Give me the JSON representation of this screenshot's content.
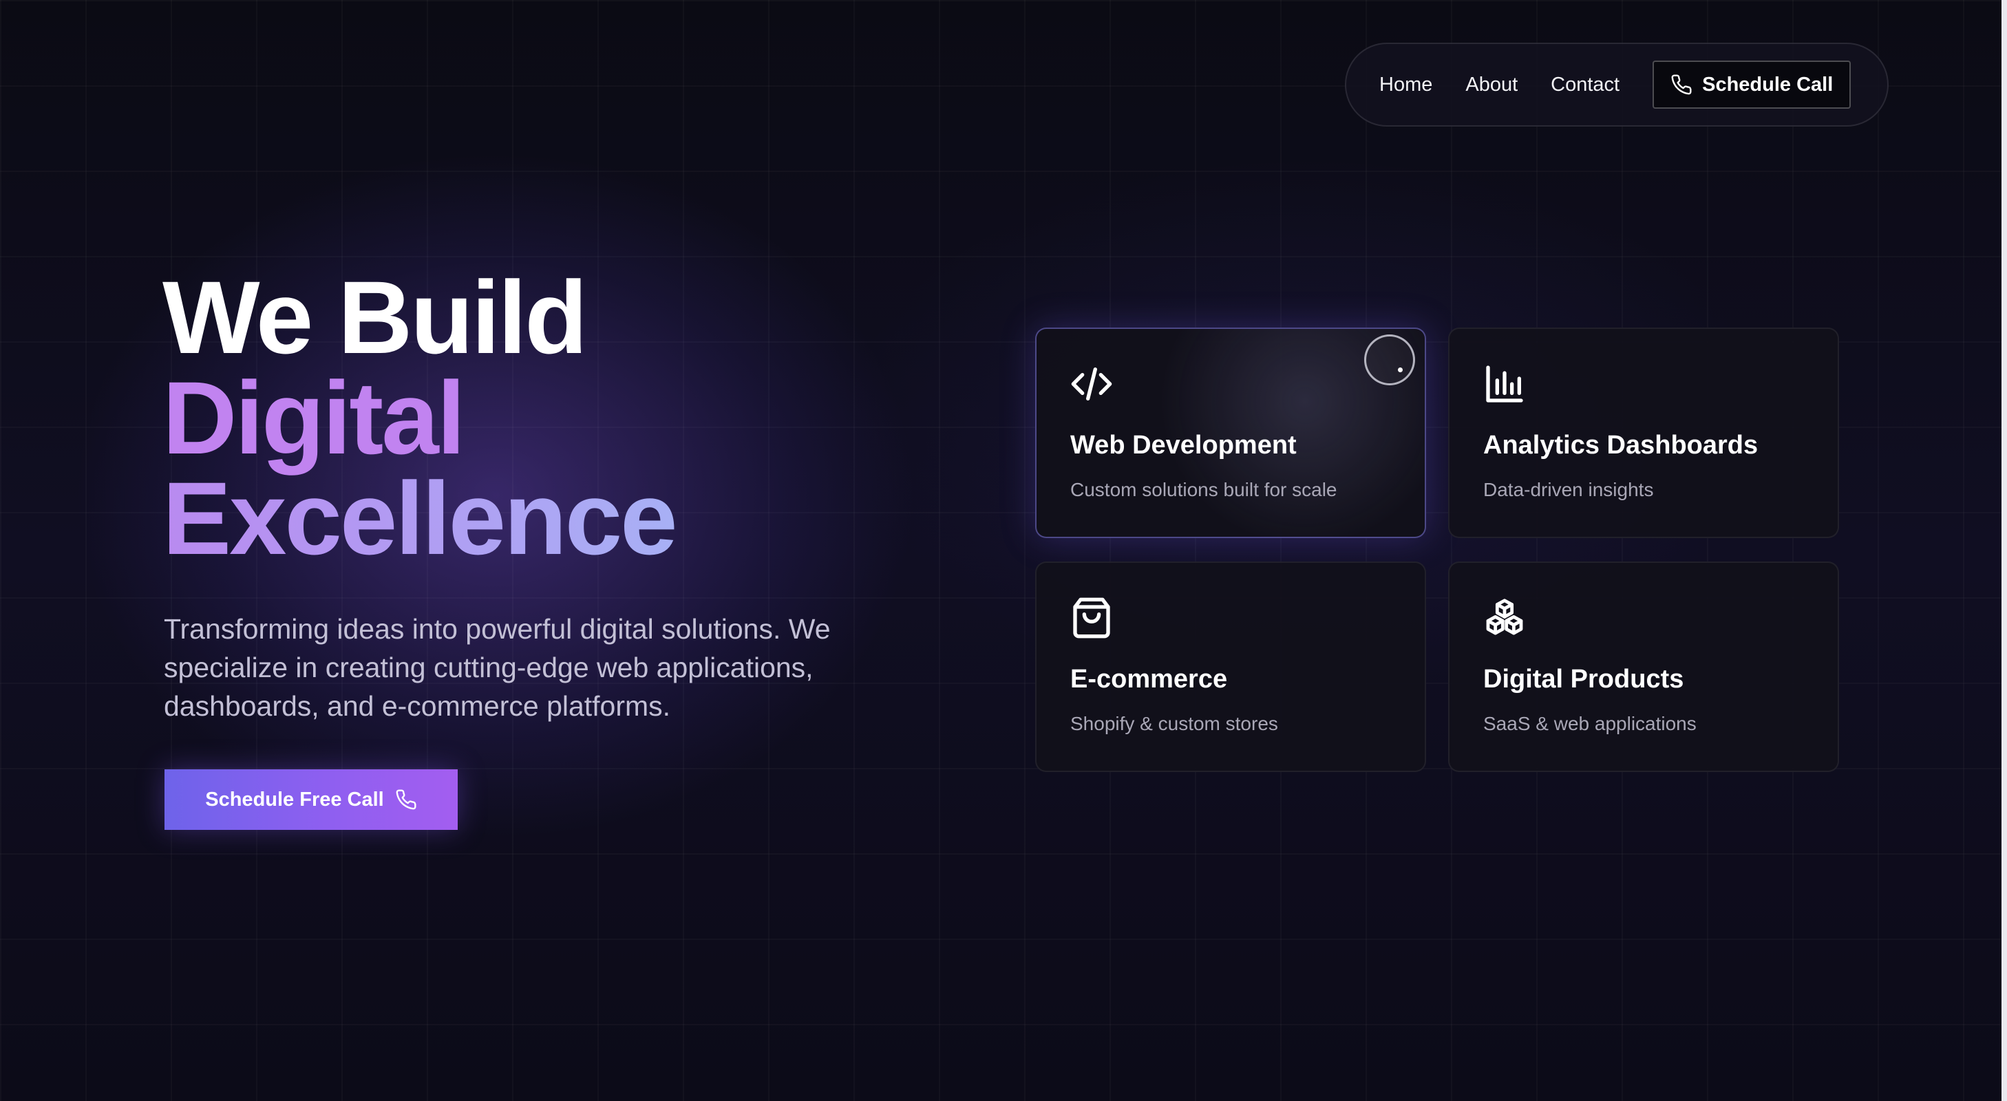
{
  "nav": {
    "links": [
      "Home",
      "About",
      "Contact"
    ],
    "cta_label": "Schedule Call",
    "cta_icon": "phone-icon"
  },
  "hero": {
    "title_line1": "We Build",
    "title_line2": "Digital",
    "title_line3": "Excellence",
    "description": "Transforming ideas into powerful digital solutions. We specialize in creating cutting-edge web applications, dashboards, and e-commerce platforms.",
    "cta_label": "Schedule Free Call",
    "cta_icon": "phone-icon"
  },
  "services": [
    {
      "title": "Web Development",
      "subtitle": "Custom solutions built for scale",
      "icon": "code-icon"
    },
    {
      "title": "Analytics Dashboards",
      "subtitle": "Data-driven insights",
      "icon": "bar-chart-icon"
    },
    {
      "title": "E-commerce",
      "subtitle": "Shopify & custom stores",
      "icon": "shopping-bag-icon"
    },
    {
      "title": "Digital Products",
      "subtitle": "SaaS & web applications",
      "icon": "boxes-icon"
    }
  ],
  "colors": {
    "background": "#0d0c19",
    "accent_purple": "#c183f0",
    "accent_gradient_start": "#6e63ea",
    "accent_gradient_end": "#a35ef0",
    "card_background": "#11101a",
    "muted_text": "#a9a7b6"
  }
}
